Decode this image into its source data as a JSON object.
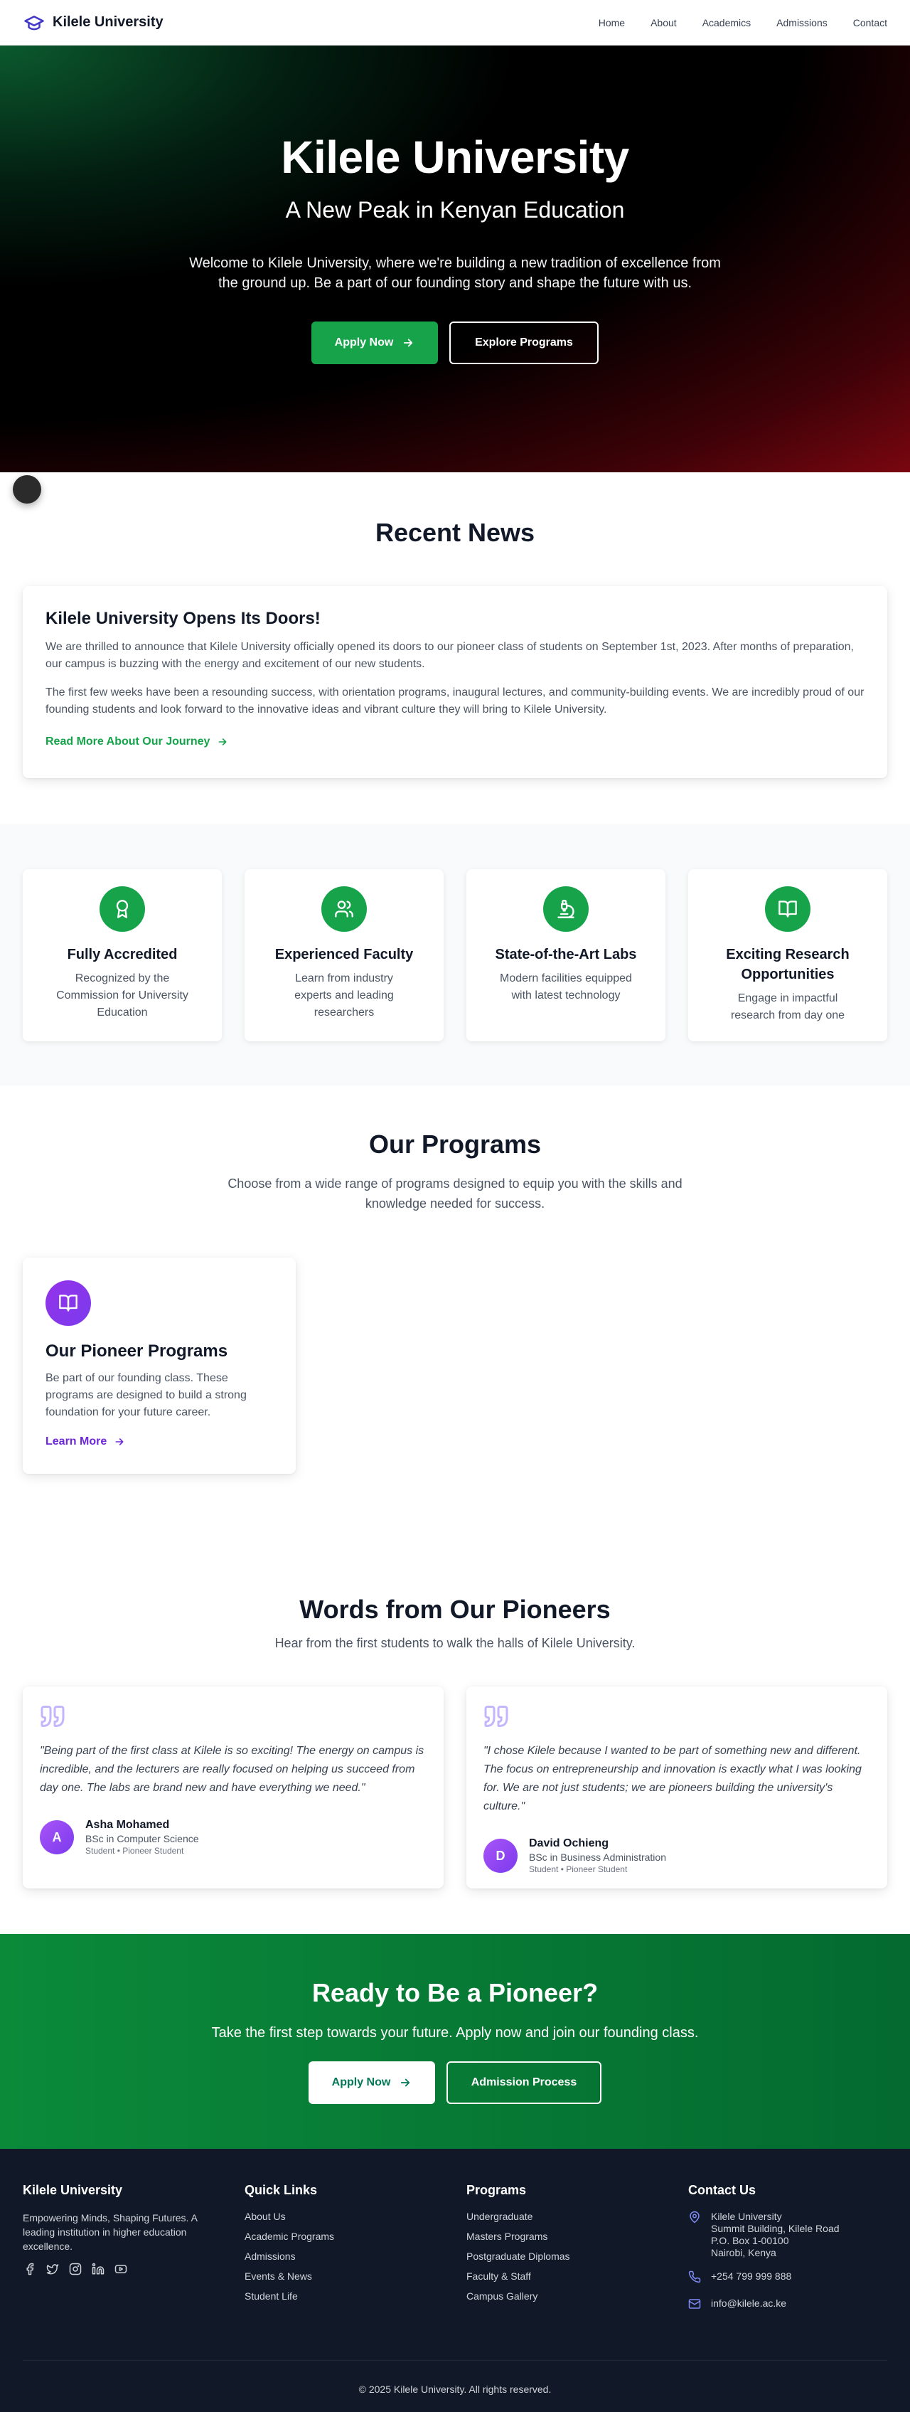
{
  "nav": {
    "brand": "Kilele University",
    "links": [
      "Home",
      "About",
      "Academics",
      "Admissions",
      "Contact"
    ]
  },
  "hero": {
    "title": "Kilele University",
    "tagline": "A New Peak in Kenyan Education",
    "description": "Welcome to Kilele University, where we're building a new tradition of excellence from the ground up. Be a part of our founding story and shape the future with us.",
    "apply_label": "Apply Now",
    "explore_label": "Explore Programs"
  },
  "news": {
    "section_title": "Recent News",
    "headline": "Kilele University Opens Its Doors!",
    "paragraph1": "We are thrilled to announce that Kilele University officially opened its doors to our pioneer class of students on September 1st, 2023. After months of preparation, our campus is buzzing with the energy and excitement of our new students.",
    "paragraph2": "The first few weeks have been a resounding success, with orientation programs, inaugural lectures, and community-building events. We are incredibly proud of our founding students and look forward to the innovative ideas and vibrant culture they will bring to Kilele University.",
    "read_more": "Read More About Our Journey"
  },
  "features": [
    {
      "icon": "award-icon",
      "title": "Fully Accredited",
      "text": "Recognized by the Commission for University Education"
    },
    {
      "icon": "users-icon",
      "title": "Experienced Faculty",
      "text": "Learn from industry experts and leading researchers"
    },
    {
      "icon": "microscope-icon",
      "title": "State-of-the-Art Labs",
      "text": "Modern facilities equipped with latest technology"
    },
    {
      "icon": "book-open-icon",
      "title": "Exciting Research Opportunities",
      "text": "Engage in impactful research from day one"
    }
  ],
  "programs": {
    "section_title": "Our Programs",
    "subtitle": "Choose from a wide range of programs designed to equip you with the skills and knowledge needed for success.",
    "card_title": "Our Pioneer Programs",
    "card_text": "Be part of our founding class. These programs are designed to build a strong foundation for your future career.",
    "learn_more": "Learn More"
  },
  "testimonials": {
    "section_title": "Words from Our Pioneers",
    "subtitle": "Hear from the first students to walk the halls of Kilele University.",
    "items": [
      {
        "quote": "\"Being part of the first class at Kilele is so exciting! The energy on campus is incredible, and the lecturers are really focused on helping us succeed from day one. The labs are brand new and have everything we need.\"",
        "initial": "A",
        "name": "Asha Mohamed",
        "program": "BSc in Computer Science",
        "role": "Student • Pioneer Student"
      },
      {
        "quote": "\"I chose Kilele because I wanted to be part of something new and different. The focus on entrepreneurship and innovation is exactly what I was looking for. We are not just students; we are pioneers building the university's culture.\"",
        "initial": "D",
        "name": "David Ochieng",
        "program": "BSc in Business Administration",
        "role": "Student • Pioneer Student"
      }
    ]
  },
  "cta": {
    "title": "Ready to Be a Pioneer?",
    "text": "Take the first step towards your future. Apply now and join our founding class.",
    "apply_label": "Apply Now",
    "process_label": "Admission Process"
  },
  "footer": {
    "brand": "Kilele University",
    "tagline": "Empowering Minds, Shaping Futures. A leading institution in higher education excellence.",
    "quick_links_title": "Quick Links",
    "quick_links": [
      "About Us",
      "Academic Programs",
      "Admissions",
      "Events & News",
      "Student Life"
    ],
    "programs_title": "Programs",
    "programs": [
      "Undergraduate",
      "Masters Programs",
      "Postgraduate Diplomas",
      "Faculty & Staff",
      "Campus Gallery"
    ],
    "contact_title": "Contact Us",
    "address": [
      "Kilele University",
      "Summit Building, Kilele Road",
      "P.O. Box 1-00100",
      "Nairobi, Kenya"
    ],
    "phone": "+254 799 999 888",
    "email": "info@kilele.ac.ke",
    "copyright": "© 2025 Kilele University. All rights reserved."
  },
  "colors": {
    "primary_green": "#16a34a",
    "accent_purple": "#7c3aed",
    "footer_bg": "#111827"
  }
}
